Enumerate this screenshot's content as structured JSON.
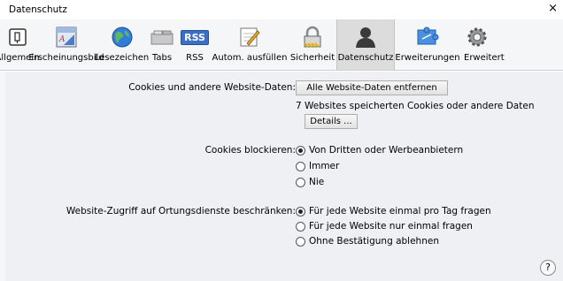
{
  "window": {
    "title": "Datenschutz",
    "close_glyph": "×"
  },
  "toolbar": {
    "items": [
      {
        "label": "Allgemein",
        "icon": "switch-icon"
      },
      {
        "label": "Erscheinungsbild",
        "icon": "appearance-icon"
      },
      {
        "label": "Lesezeichen",
        "icon": "globe-icon"
      },
      {
        "label": "Tabs",
        "icon": "tabs-icon"
      },
      {
        "label": "RSS",
        "icon": "rss-icon",
        "icon_text": "RSS"
      },
      {
        "label": "Autom. ausfüllen",
        "icon": "pencil-icon"
      },
      {
        "label": "Sicherheit",
        "icon": "lock-icon"
      },
      {
        "label": "Datenschutz",
        "icon": "person-icon",
        "selected": true
      },
      {
        "label": "Erweiterungen",
        "icon": "puzzle-icon"
      },
      {
        "label": "Erweitert",
        "icon": "gear-icon"
      }
    ]
  },
  "cookies": {
    "label": "Cookies und andere Website-Daten:",
    "remove_button": "Alle Website-Daten entfernen",
    "info": "7 Websites speicherten Cookies oder andere Daten",
    "details_button": "Details ..."
  },
  "block": {
    "label": "Cookies blockieren:",
    "options": [
      "Von Dritten oder Werbeanbietern",
      "Immer",
      "Nie"
    ],
    "selected_index": 0
  },
  "location": {
    "label": "Website-Zugriff auf Ortungsdienste beschränken:",
    "options": [
      "Für jede Website einmal pro Tag fragen",
      "Für jede Website nur einmal fragen",
      "Ohne Bestätigung ablehnen"
    ],
    "selected_index": 0
  },
  "help": {
    "glyph": "?"
  },
  "colors": {
    "toolbar_bg": "#f5f6f8",
    "content_bg": "#eef0f4",
    "selected_tab_bg": "#dcdcdc"
  }
}
